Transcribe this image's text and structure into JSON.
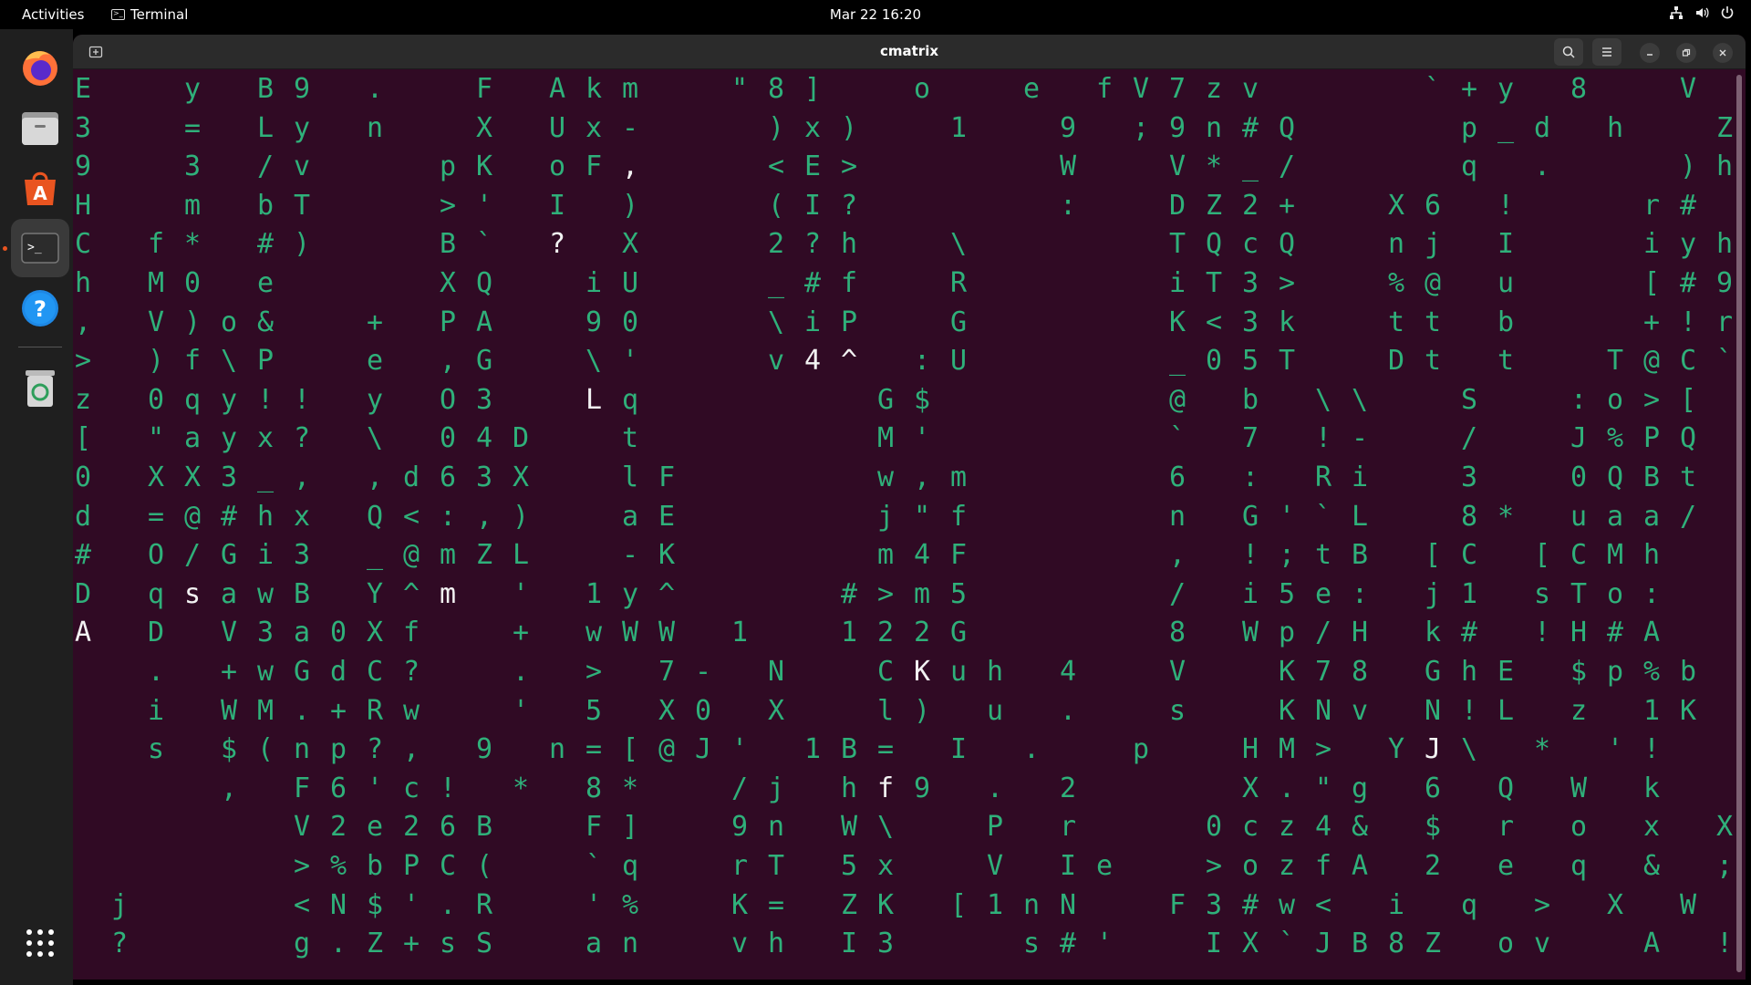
{
  "topbar": {
    "activities": "Activities",
    "app_name": "Terminal",
    "clock": "Mar 22  16:20"
  },
  "dock": {
    "items": [
      "firefox-icon",
      "files-icon",
      "app-center-icon",
      "terminal-icon",
      "help-icon",
      "trash-icon",
      "show-apps-icon"
    ]
  },
  "window": {
    "title": "cmatrix"
  },
  "colors": {
    "background": "#300a24",
    "matrix_green": "#2fb07a",
    "highlight": "#f2f2f2"
  },
  "matrix": {
    "row_count": 23,
    "highlight_marker": "~",
    "rows": [
      "E  y B9 .  F Akm  \"8]  o  e fV7zv    `+y 8  V",
      "3  = Ly n  X Ux-   )x)  1  9 ;9n#Q    p_d h  Z",
      "9  3 /v   pK oF,   <E>     W  V*_/    q .   )h",
      "H  m bT   >' I )   (I?     :  DZ2+  X6 !   r#",
      "C f* #)   B` ? X   2?h  \\     TQcQ  nj I   iyh",
      "h M0 e    XQ  iU   _#f  R     iT3>  %@ u   [#9",
      ", V)o&  + PA  90   \\iP  G     K<3k  tt b   +!r",
      "> )f\\P  e ,G  \\'   v4^ :U     _05T  Dt t  T@C`",
      "z 0qy!! y O3  Lq      G$      @ b \\\\  S  :o>[",
      "[ \"ayx? \\ 04D  t      M'      ` 7 !-  /  J%PQ",
      "0 XX3_, ,d63X  lF     w,m     6 : Ri  3  0QBt",
      "d =@#hx Q<:,)  aE     j\"f     n G'`L  8* uaa/",
      "# O/Gi3 _@mZL  -K     m4F     , !;tB [C [CMh",
      "D qsawB Y^m ' 1y^    #>m5     / i5e: j1 sTo:",
      "A D V3a0Xf  + wWW 1  122G     8 Wp/H k# !H#A",
      "  . +wGdC?  . > 7- N  CKuh 4  V  K78 GhE $p%b",
      "  i WM.+Rw  ' 5 X0 X  l) u .  s  KNv N!L z 1K",
      "  s $(np?, 9 n=[@J' 1B= I .  p  HM> YJ\\ * '!",
      "    , F6'c! * 8*  /j hf9 . 2    X.\"g 6 Q W k",
      "      V2e26B  F]  9n W\\  P r   0cz4& $ r o x X",
      "      >%bPC(  `q  rT 5x  V Ie  >ozfA 2 e q & ;",
      " j    <N$'.R  '%  K= ZK [1nN  F3#w< i q > X W",
      " ?    g.Z+sS  an  vh I3   s#'  IX`JB8Z ov  A !"
    ],
    "highlights": [
      "1,9",
      "0,10",
      "1,23",
      "2,15",
      "4,13",
      "7,20",
      "7,21",
      "7,22",
      "8,14",
      "13,3",
      "13,10",
      "14,0",
      "14,31",
      "15,23",
      "15,40",
      "17,31",
      "17,37",
      "18,22"
    ]
  }
}
